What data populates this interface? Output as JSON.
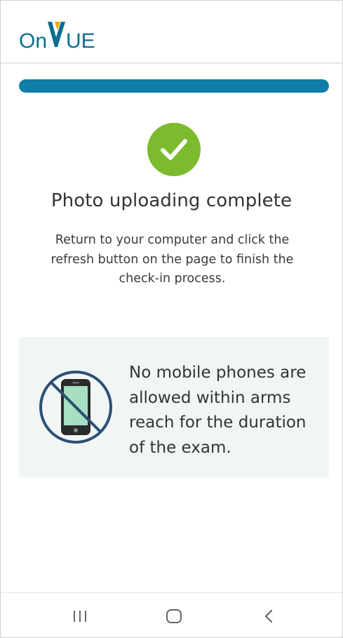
{
  "header": {
    "logo_text": "OnVUE",
    "logo_color": "#0b6e8f"
  },
  "progress": {
    "fraction": 1.0,
    "color": "#0d7ea6"
  },
  "status": {
    "icon": "check-circle-icon",
    "icon_color": "#7cbb2e",
    "title": "Photo uploading complete",
    "description": "Return to your computer and click the refresh button on the page to finish the check-in process."
  },
  "notice": {
    "icon": "no-mobile-phone-icon",
    "text": "No mobile phones are allowed within arms reach for the duration of the exam.",
    "background": "#f1f6f5"
  },
  "system_nav": {
    "recent_icon": "recent-apps-icon",
    "home_icon": "home-icon",
    "back_icon": "back-icon"
  }
}
